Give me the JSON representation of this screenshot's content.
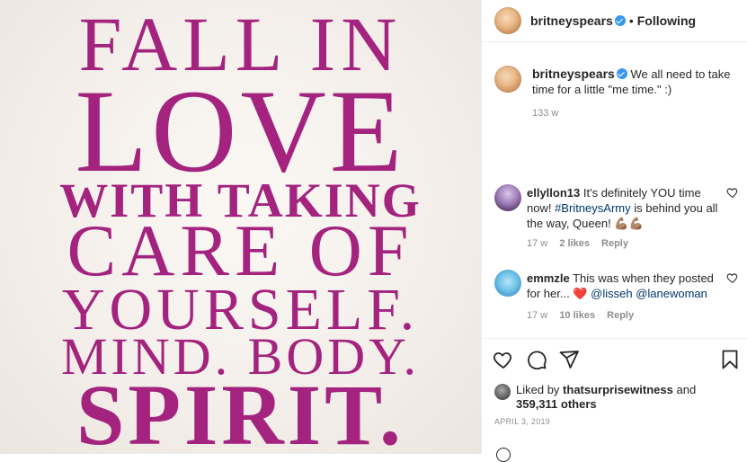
{
  "post": {
    "image_quote": [
      "FALL IN",
      "LOVE",
      "WITH TAKING",
      "CARE OF",
      "YOURSELF.",
      "MIND. BODY.",
      "SPIRIT."
    ]
  },
  "header": {
    "username": "britneyspears",
    "separator": "•",
    "follow_status": "Following"
  },
  "caption": {
    "username": "britneyspears",
    "text": "We all need to take time for a little \"me time.\" :)",
    "time": "133 w"
  },
  "comments": [
    {
      "username": "ellyllon13",
      "text_before": "It's definitely YOU time now! ",
      "hashtag": "#BritneysArmy",
      "text_after": " is behind you all the way, Queen! 💪🏽💪🏽",
      "time": "17 w",
      "likes": "2 likes",
      "reply": "Reply"
    },
    {
      "username": "emmzle",
      "text_before": "This was when they posted for her... ",
      "heart": "❤️",
      "mention1": "@lisseh",
      "mention2": "@lanewoman",
      "time": "17 w",
      "likes": "10 likes",
      "reply": "Reply"
    }
  ],
  "likes": {
    "prefix": "Liked by ",
    "user": "thatsurprisewitness",
    "middle": " and",
    "count": "359,311 others"
  },
  "date": "APRIL 3, 2019",
  "icons": {
    "like": "heart-icon",
    "comment": "comment-icon",
    "share": "share-icon",
    "save": "bookmark-icon"
  },
  "colors": {
    "quote": "#a3237f",
    "verified": "#3897f0",
    "link": "#00376b",
    "muted": "#8e8e8e"
  }
}
